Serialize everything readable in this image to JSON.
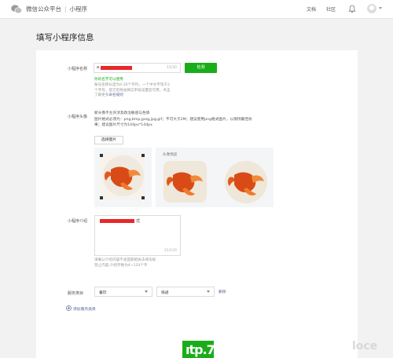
{
  "topbar": {
    "platform": "微信公众平台",
    "separator": "|",
    "section": "小程序",
    "nav_docs": "文档",
    "nav_community": "社区"
  },
  "page": {
    "title": "填写小程序信息"
  },
  "form": {
    "name": {
      "label": "小程序名称",
      "value_prefix": "a",
      "counter": "15/30",
      "check_button": "检测",
      "success": "你的名字可以使用",
      "hint_line1": "账号名称长度为4-30个字符，一个中文字等于2",
      "hint_line2": "个字符。提交后将由微信审核设置后可用，点击",
      "hint_line3_prefix": "了解更多",
      "hint_link": "命名规则"
    },
    "avatar": {
      "label": "小程序头像",
      "desc_line1": "新头像不允许涉及政治敏感与色情",
      "desc_line2": "图片格式必须为：png,bmp,jpeg,jpg,gif；不可大于2M；建议使用png格式图片，以保持最佳效",
      "desc_line3": "果；建议图片尺寸为144px*144px",
      "select_button": "选择图片",
      "preview_label": "头像预览"
    },
    "intro": {
      "label": "小程序介绍",
      "value_suffix": "式",
      "counter": "21/120",
      "hint_line1": "请确认介绍内容不含国家相关法律法规",
      "hint_line2": "禁止内容,介绍字数为4~120个字"
    },
    "category": {
      "label": "服务类目",
      "primary": "餐饮",
      "secondary": "快递",
      "delete_link": "删除",
      "add_link": "添加服务类目"
    }
  },
  "watermark": {
    "left": "ıtp.7",
    "right": "loce"
  },
  "colors": {
    "accent": "#1aad19",
    "link": "#576b95",
    "redaction": "#e8282b"
  }
}
